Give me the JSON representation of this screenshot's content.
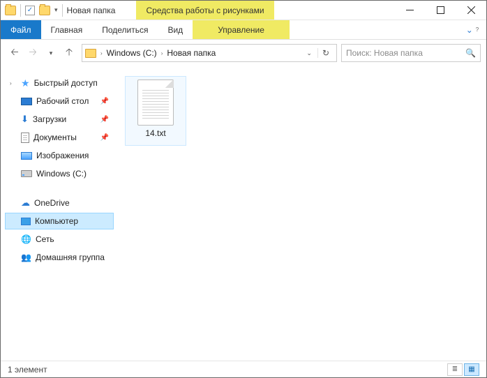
{
  "titlebar": {
    "title": "Новая папка",
    "context_tab": "Средства работы с рисунками"
  },
  "ribbon": {
    "file": "Файл",
    "main": "Главная",
    "share": "Поделиться",
    "view": "Вид",
    "manage": "Управление"
  },
  "address": {
    "crumbs": [
      "Windows (C:)",
      "Новая папка"
    ]
  },
  "search": {
    "placeholder": "Поиск: Новая папка"
  },
  "nav": {
    "quick_access": "Быстрый доступ",
    "desktop": "Рабочий стол",
    "downloads": "Загрузки",
    "documents": "Документы",
    "pictures": "Изображения",
    "drive_c": "Windows (C:)",
    "onedrive": "OneDrive",
    "computer": "Компьютер",
    "network": "Сеть",
    "homegroup": "Домашняя группа"
  },
  "files": [
    {
      "name": "14.txt"
    }
  ],
  "status": {
    "count_text": "1 элемент"
  }
}
